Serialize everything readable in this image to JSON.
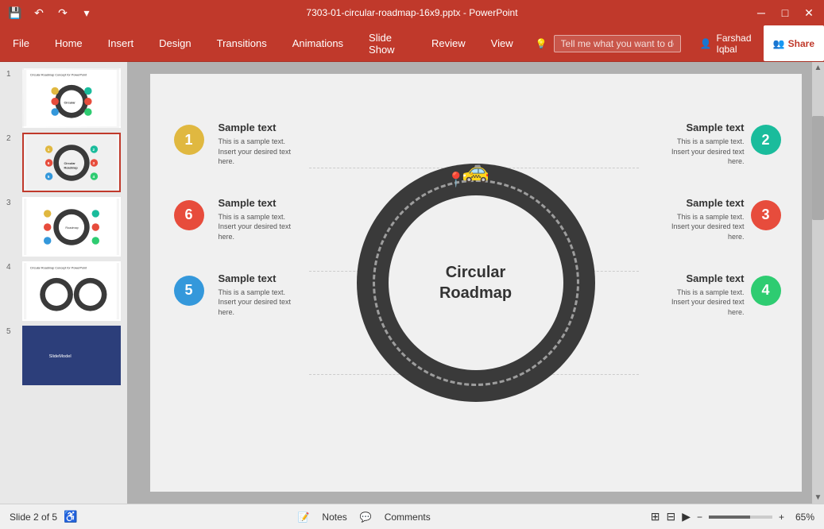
{
  "titleBar": {
    "title": "7303-01-circular-roadmap-16x9.pptx - PowerPoint",
    "minimize": "─",
    "maximize": "□",
    "close": "✕"
  },
  "ribbon": {
    "tabs": [
      {
        "label": "File",
        "active": false
      },
      {
        "label": "Home",
        "active": false
      },
      {
        "label": "Insert",
        "active": false
      },
      {
        "label": "Design",
        "active": false
      },
      {
        "label": "Transitions",
        "active": false
      },
      {
        "label": "Animations",
        "active": false
      },
      {
        "label": "Slide Show",
        "active": false
      },
      {
        "label": "Review",
        "active": false
      },
      {
        "label": "View",
        "active": false
      }
    ],
    "searchPlaceholder": "Tell me what you want to do...",
    "userName": "Farshad Iqbal",
    "shareLabel": "Share"
  },
  "slides": [
    {
      "number": "1",
      "active": false
    },
    {
      "number": "2",
      "active": true
    },
    {
      "number": "3",
      "active": false
    },
    {
      "number": "4",
      "active": false
    },
    {
      "number": "5",
      "active": false
    }
  ],
  "slide": {
    "centerText1": "Circular",
    "centerText2": "Roadmap",
    "items": [
      {
        "id": 1,
        "color": "#e0b840",
        "title": "Sample text",
        "desc": "This is a sample text.\nInsert your desired text\nhere.",
        "side": "left"
      },
      {
        "id": 6,
        "color": "#e74c3c",
        "title": "Sample text",
        "desc": "This is a sample text.\nInsert your desired text\nhere.",
        "side": "left"
      },
      {
        "id": 5,
        "color": "#3498db",
        "title": "Sample text",
        "desc": "This is a sample text.\nInsert your desired text\nhere.",
        "side": "left"
      },
      {
        "id": 2,
        "color": "#1abc9c",
        "title": "Sample text",
        "desc": "This is a sample text.\nInsert your desired text\nhere.",
        "side": "right"
      },
      {
        "id": 3,
        "color": "#e74c3c",
        "title": "Sample text",
        "desc": "This is a sample text.\nInsert your desired text\nhere.",
        "side": "right"
      },
      {
        "id": 4,
        "color": "#2ecc71",
        "title": "Sample text",
        "desc": "This is a sample text.\nInsert your desired text\nhere.",
        "side": "right"
      }
    ]
  },
  "statusBar": {
    "slideInfo": "Slide 2 of 5",
    "notesLabel": "Notes",
    "commentsLabel": "Comments",
    "zoomLevel": "65%"
  }
}
